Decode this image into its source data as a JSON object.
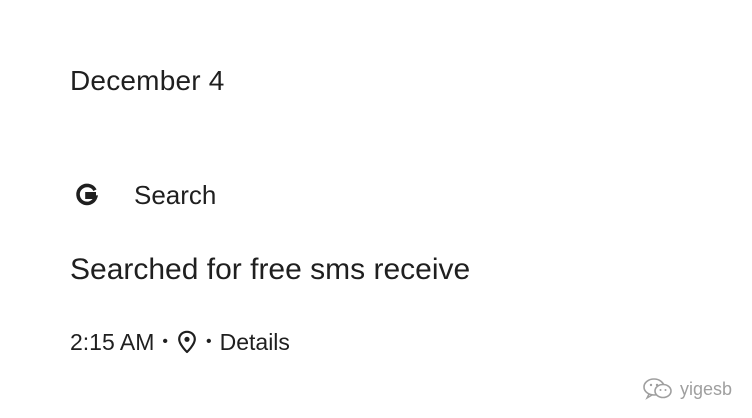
{
  "activity": {
    "date": "December 4",
    "product": {
      "icon": "google-g-icon",
      "name": "Search"
    },
    "title": "Searched for free sms receive",
    "meta": {
      "time": "2:15 AM",
      "separator": "•",
      "location_icon": "location-pin-icon",
      "details_label": "Details"
    }
  },
  "watermark": {
    "icon": "wechat-icon",
    "text": "yigesb"
  }
}
